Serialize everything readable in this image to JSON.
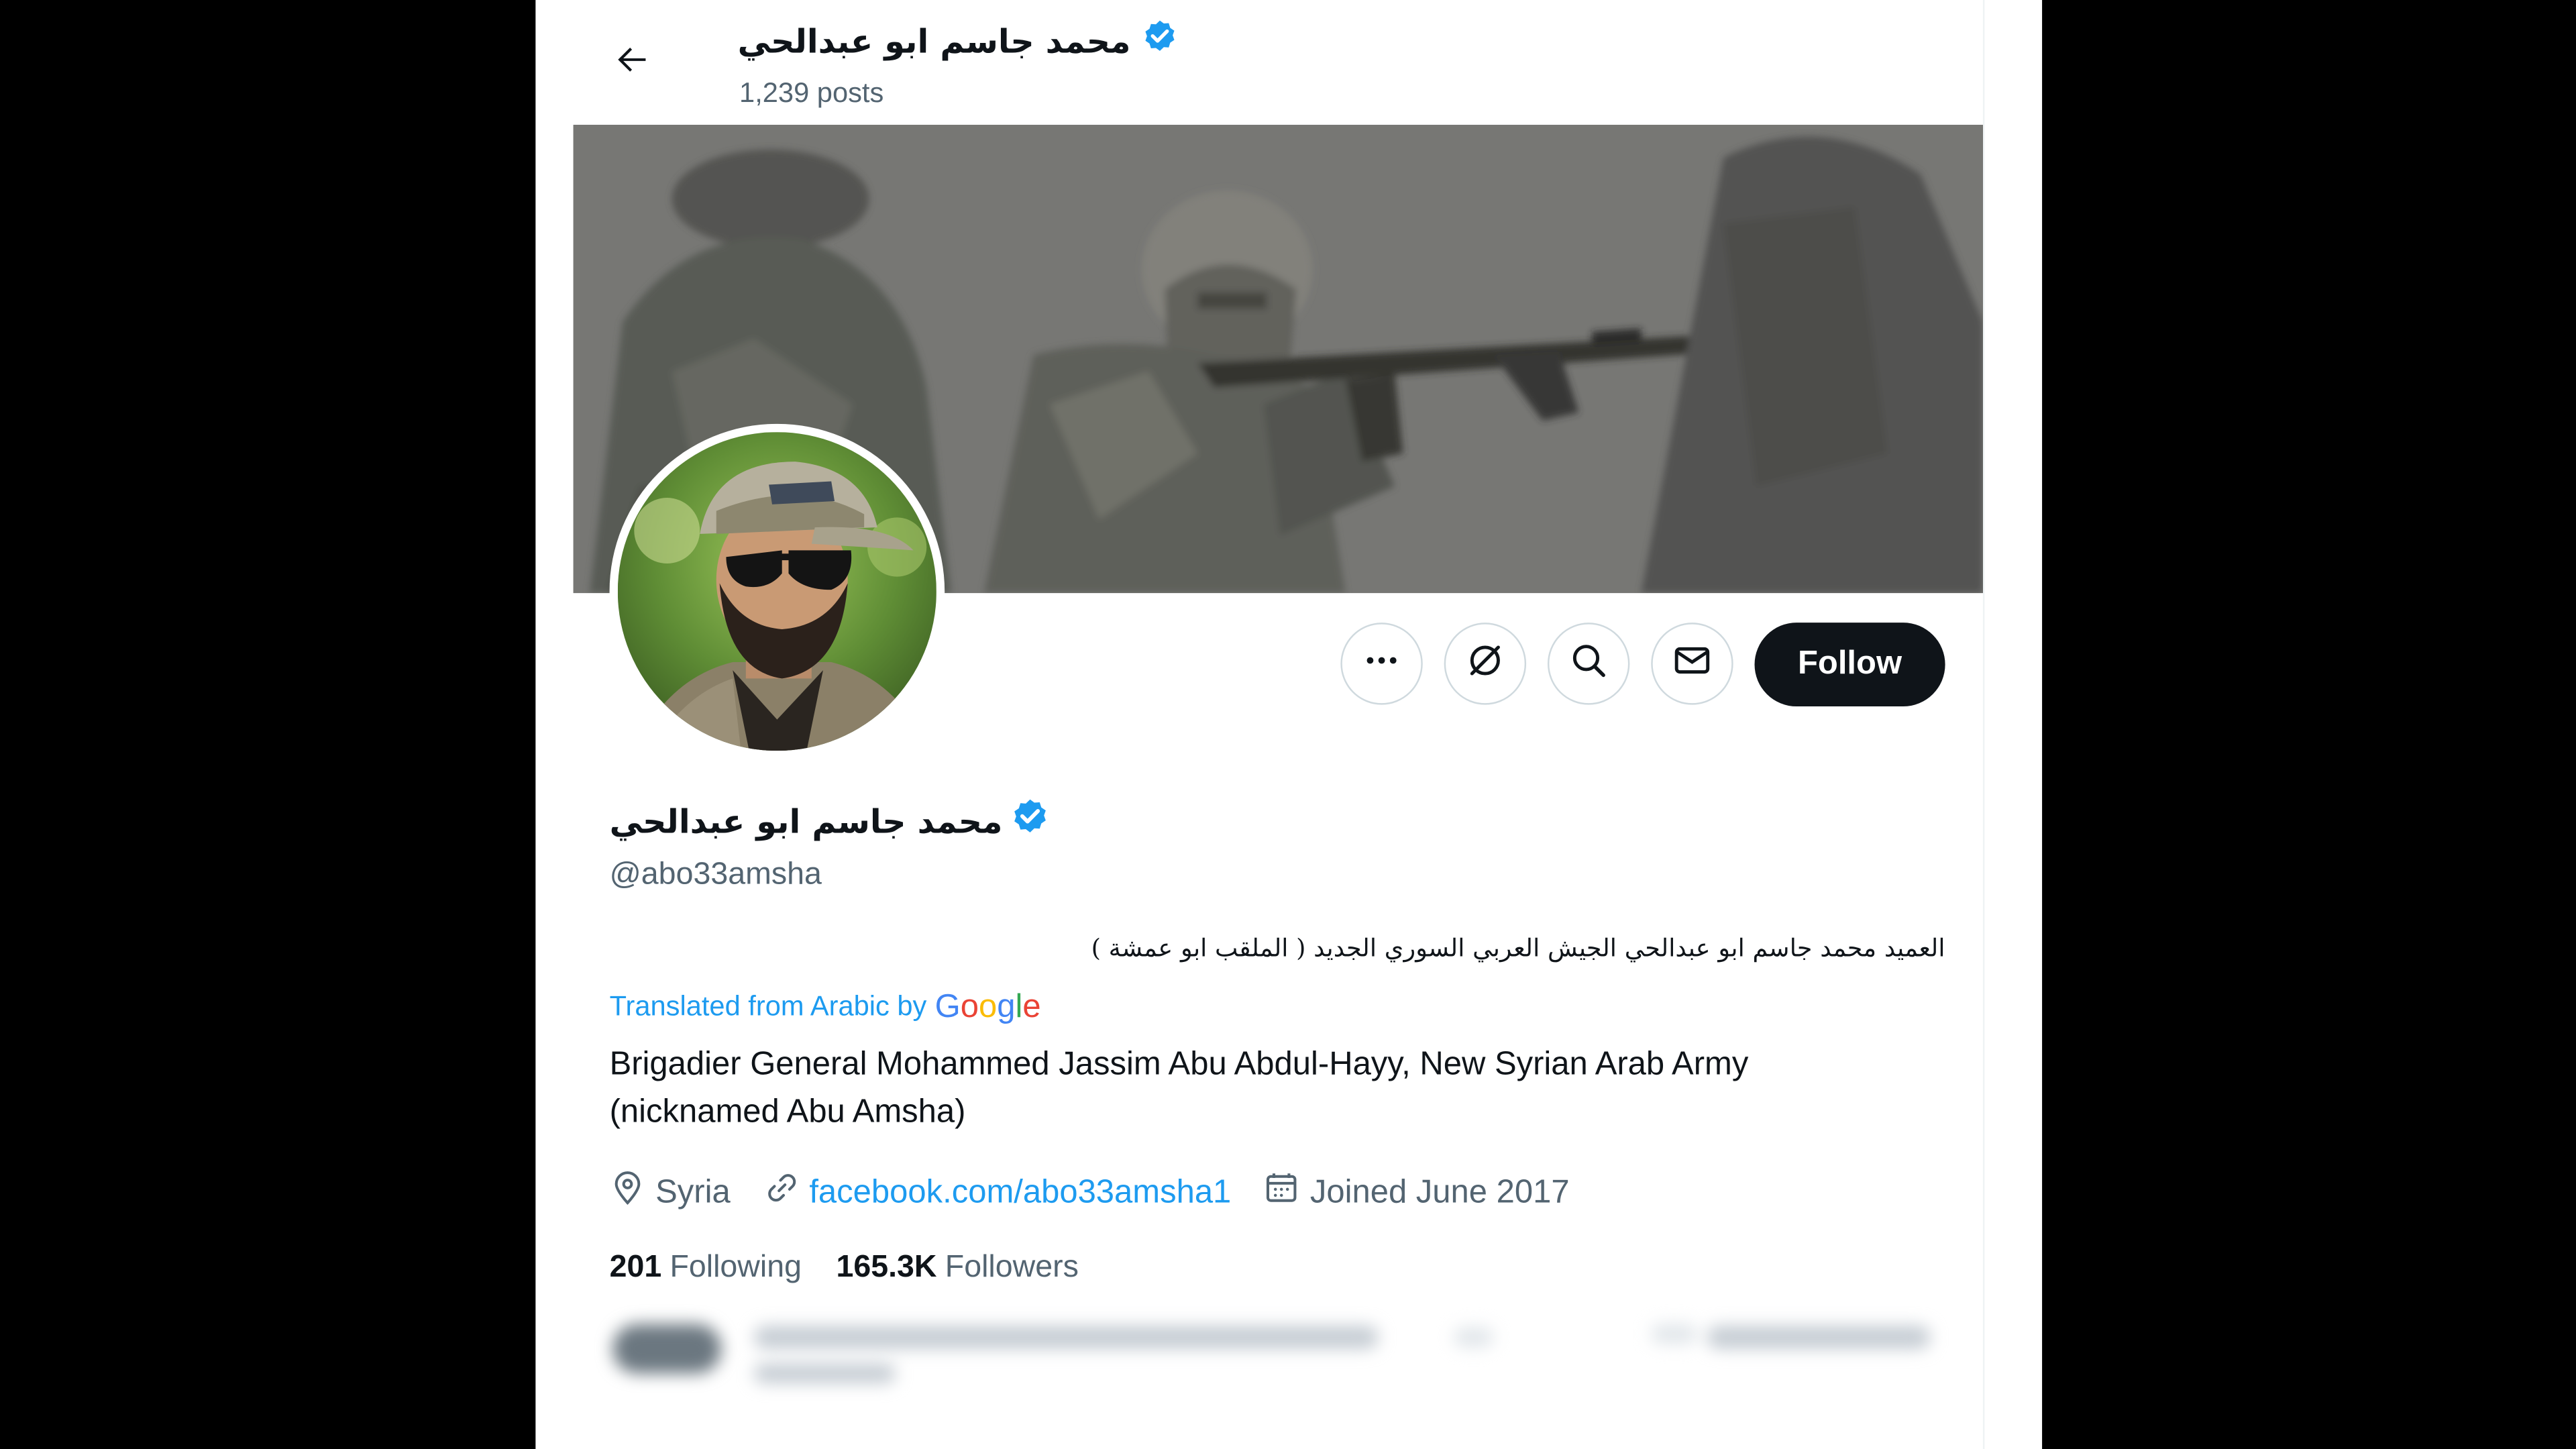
{
  "colors": {
    "text_primary": "#0f1419",
    "text_secondary": "#536471",
    "accent_blue": "#1d9bf0",
    "verified_badge": "#1d9bf0",
    "follow_button_bg": "#0f1419",
    "follow_button_text": "#ffffff"
  },
  "header": {
    "back_icon": "arrow-left-icon",
    "name": "محمد جاسم ابو عبدالحي",
    "verified_icon": "verified-badge-icon",
    "posts_count": "1,239 posts"
  },
  "actions": {
    "more_icon": "more-icon",
    "grok_icon": "grok-slash-icon",
    "search_icon": "search-icon",
    "message_icon": "mail-icon",
    "follow_label": "Follow"
  },
  "profile": {
    "display_name": "محمد جاسم ابو عبدالحي",
    "handle": "@abo33amsha",
    "bio_arabic": "العميد محمد جاسم ابو عبدالحي الجيش العربي السوري الجديد ( الملقب ابو عمشة )",
    "translated_label": "Translated from Arabic by",
    "translation_provider": "Google",
    "bio_translated": "Brigadier General Mohammed Jassim Abu Abdul-Hayy, New Syrian Arab Army (nicknamed Abu Amsha)",
    "location": "Syria",
    "location_icon": "location-pin-icon",
    "website": "facebook.com/abo33amsha1",
    "website_icon": "link-icon",
    "joined": "Joined June 2017",
    "joined_icon": "calendar-icon",
    "following_count": "201",
    "following_label": "Following",
    "followers_count": "165.3K",
    "followers_label": "Followers"
  }
}
